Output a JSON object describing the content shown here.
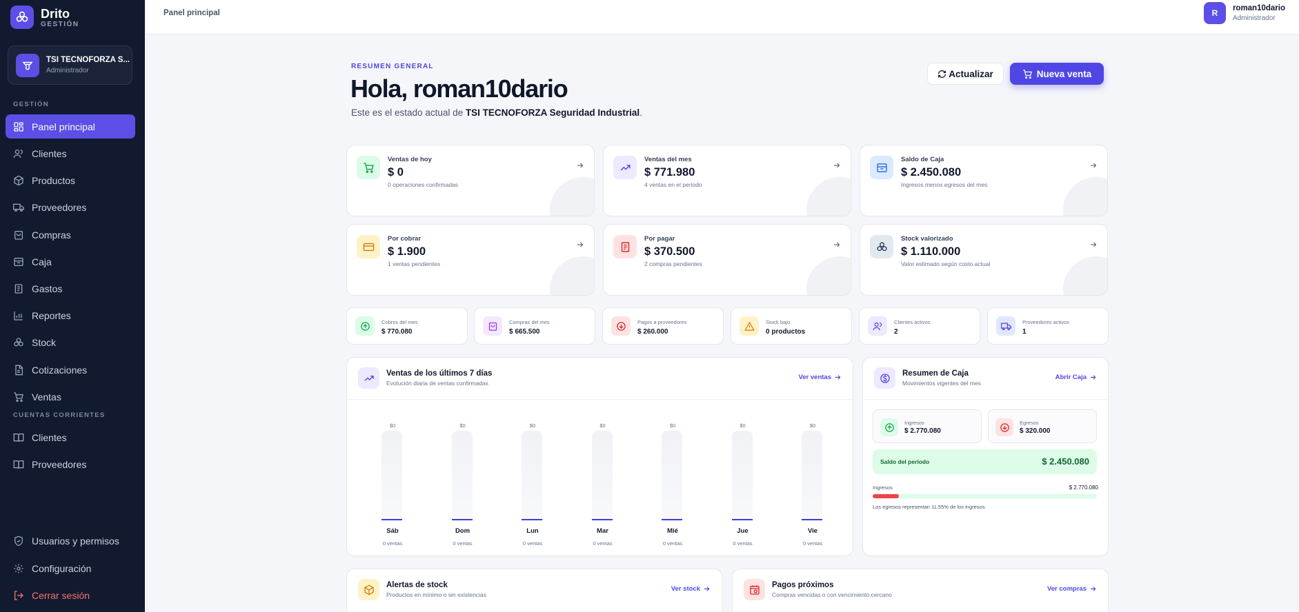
{
  "brand": {
    "name": "Drito",
    "sub": "GESTIÓN"
  },
  "company": {
    "name": "TSI TECNOFORZA S...",
    "role": "Administrador"
  },
  "sidebar": {
    "section_gestion": "GESTIÓN",
    "items": [
      {
        "label": "Panel principal",
        "icon": "dashboard-icon"
      },
      {
        "label": "Clientes",
        "icon": "users-icon"
      },
      {
        "label": "Productos",
        "icon": "box-icon"
      },
      {
        "label": "Proveedores",
        "icon": "truck-icon"
      },
      {
        "label": "Compras",
        "icon": "shopping-bag-icon"
      },
      {
        "label": "Caja",
        "icon": "cash-box-icon"
      },
      {
        "label": "Gastos",
        "icon": "receipt-icon"
      },
      {
        "label": "Reportes",
        "icon": "bar-chart-icon"
      },
      {
        "label": "Stock",
        "icon": "boxes-icon"
      },
      {
        "label": "Cotizaciones",
        "icon": "file-icon"
      },
      {
        "label": "Ventas",
        "icon": "cart-icon"
      }
    ],
    "section_cuentas": "CUENTAS CORRIENTES",
    "cuentas": [
      {
        "label": "Clientes",
        "icon": "book-icon"
      },
      {
        "label": "Proveedores",
        "icon": "book-icon"
      }
    ],
    "bottom": [
      {
        "label": "Usuarios y permisos",
        "icon": "shield-icon"
      },
      {
        "label": "Configuración",
        "icon": "gear-icon"
      },
      {
        "label": "Cerrar sesión",
        "icon": "logout-icon"
      }
    ]
  },
  "topbar": {
    "breadcrumb": "Panel principal",
    "user_initial": "R",
    "user_name": "roman10dario",
    "user_role": "Administrador"
  },
  "header": {
    "overline": "RESUMEN GENERAL",
    "greeting": "Hola, roman10dario",
    "desc_prefix": "Este es el estado actual de ",
    "desc_company": "TSI TECNOFORZA Seguridad Industrial",
    "desc_suffix": ".",
    "refresh_label": "Actualizar",
    "new_sale_label": "Nueva venta"
  },
  "stats": [
    {
      "label": "Ventas de hoy",
      "value": "$ 0",
      "sub": "0 operaciones confirmadas",
      "icon": "cart-icon"
    },
    {
      "label": "Ventas del mes",
      "value": "$ 771.980",
      "sub": "4 ventas en el periodo",
      "icon": "trending-up-icon"
    },
    {
      "label": "Saldo de Caja",
      "value": "$ 2.450.080",
      "sub": "Ingresos menos egresos del mes",
      "icon": "cash-box-icon"
    },
    {
      "label": "Por cobrar",
      "value": "$ 1.900",
      "sub": "1 ventas pendientes",
      "icon": "credit-card-icon"
    },
    {
      "label": "Por pagar",
      "value": "$ 370.500",
      "sub": "2 compras pendientes",
      "icon": "receipt-icon"
    },
    {
      "label": "Stock valorizado",
      "value": "$ 1.110.000",
      "sub": "Valor estimado según costo actual",
      "icon": "boxes-icon"
    }
  ],
  "minis": [
    {
      "label": "Cobros del mes",
      "value": "$ 770.080",
      "icon": "arrow-up-circle-icon"
    },
    {
      "label": "Compras del mes",
      "value": "$ 665.500",
      "icon": "shopping-bag-icon"
    },
    {
      "label": "Pagos a proveedores",
      "value": "$ 260.000",
      "icon": "arrow-down-circle-icon"
    },
    {
      "label": "Stock bajo",
      "value": "0 productos",
      "icon": "warning-icon"
    },
    {
      "label": "Clientes activos",
      "value": "2",
      "icon": "users-icon"
    },
    {
      "label": "Proveedores activos",
      "value": "1",
      "icon": "truck-icon"
    }
  ],
  "sales_panel": {
    "title": "Ventas de los últimos 7 días",
    "subtitle": "Evolución diaria de ventas confirmadas",
    "link": "Ver ventas"
  },
  "chart_data": {
    "type": "bar",
    "categories": [
      "Sáb",
      "Dom",
      "Lun",
      "Mar",
      "Mié",
      "Jue",
      "Vie"
    ],
    "values": [
      0,
      0,
      0,
      0,
      0,
      0,
      0
    ],
    "value_labels": [
      "$0",
      "$0",
      "$0",
      "$0",
      "$0",
      "$0",
      "$0"
    ],
    "counts": [
      "0 ventas",
      "0 ventas",
      "0 ventas",
      "0 ventas",
      "0 ventas",
      "0 ventas",
      "0 ventas"
    ]
  },
  "caja_panel": {
    "title": "Resumen de Caja",
    "subtitle": "Movimientos vigentes del mes",
    "link": "Abrir Caja",
    "ingresos_label": "Ingresos",
    "ingresos_value": "$ 2.770.080",
    "egresos_label": "Egresos",
    "egresos_value": "$ 320.000",
    "saldo_label": "Saldo del período",
    "saldo_value": "$ 2.450.080",
    "progress_label": "Ingresos",
    "progress_value": "$ 2.770.080",
    "egresos_ratio": 0.1155,
    "note": "Los egresos representan 11,55% de los ingresos."
  },
  "stock_panel": {
    "title": "Alertas de stock",
    "subtitle": "Productos en mínimo o sin existencias",
    "link": "Ver stock"
  },
  "pagos_panel": {
    "title": "Pagos próximos",
    "subtitle": "Compras vencidas o con vencimiento cercano",
    "link": "Ver compras"
  },
  "colors": {
    "accent": "#4f46e5",
    "sidebar": "#111a2e",
    "danger": "#ef4444",
    "success": "#16a34a"
  }
}
